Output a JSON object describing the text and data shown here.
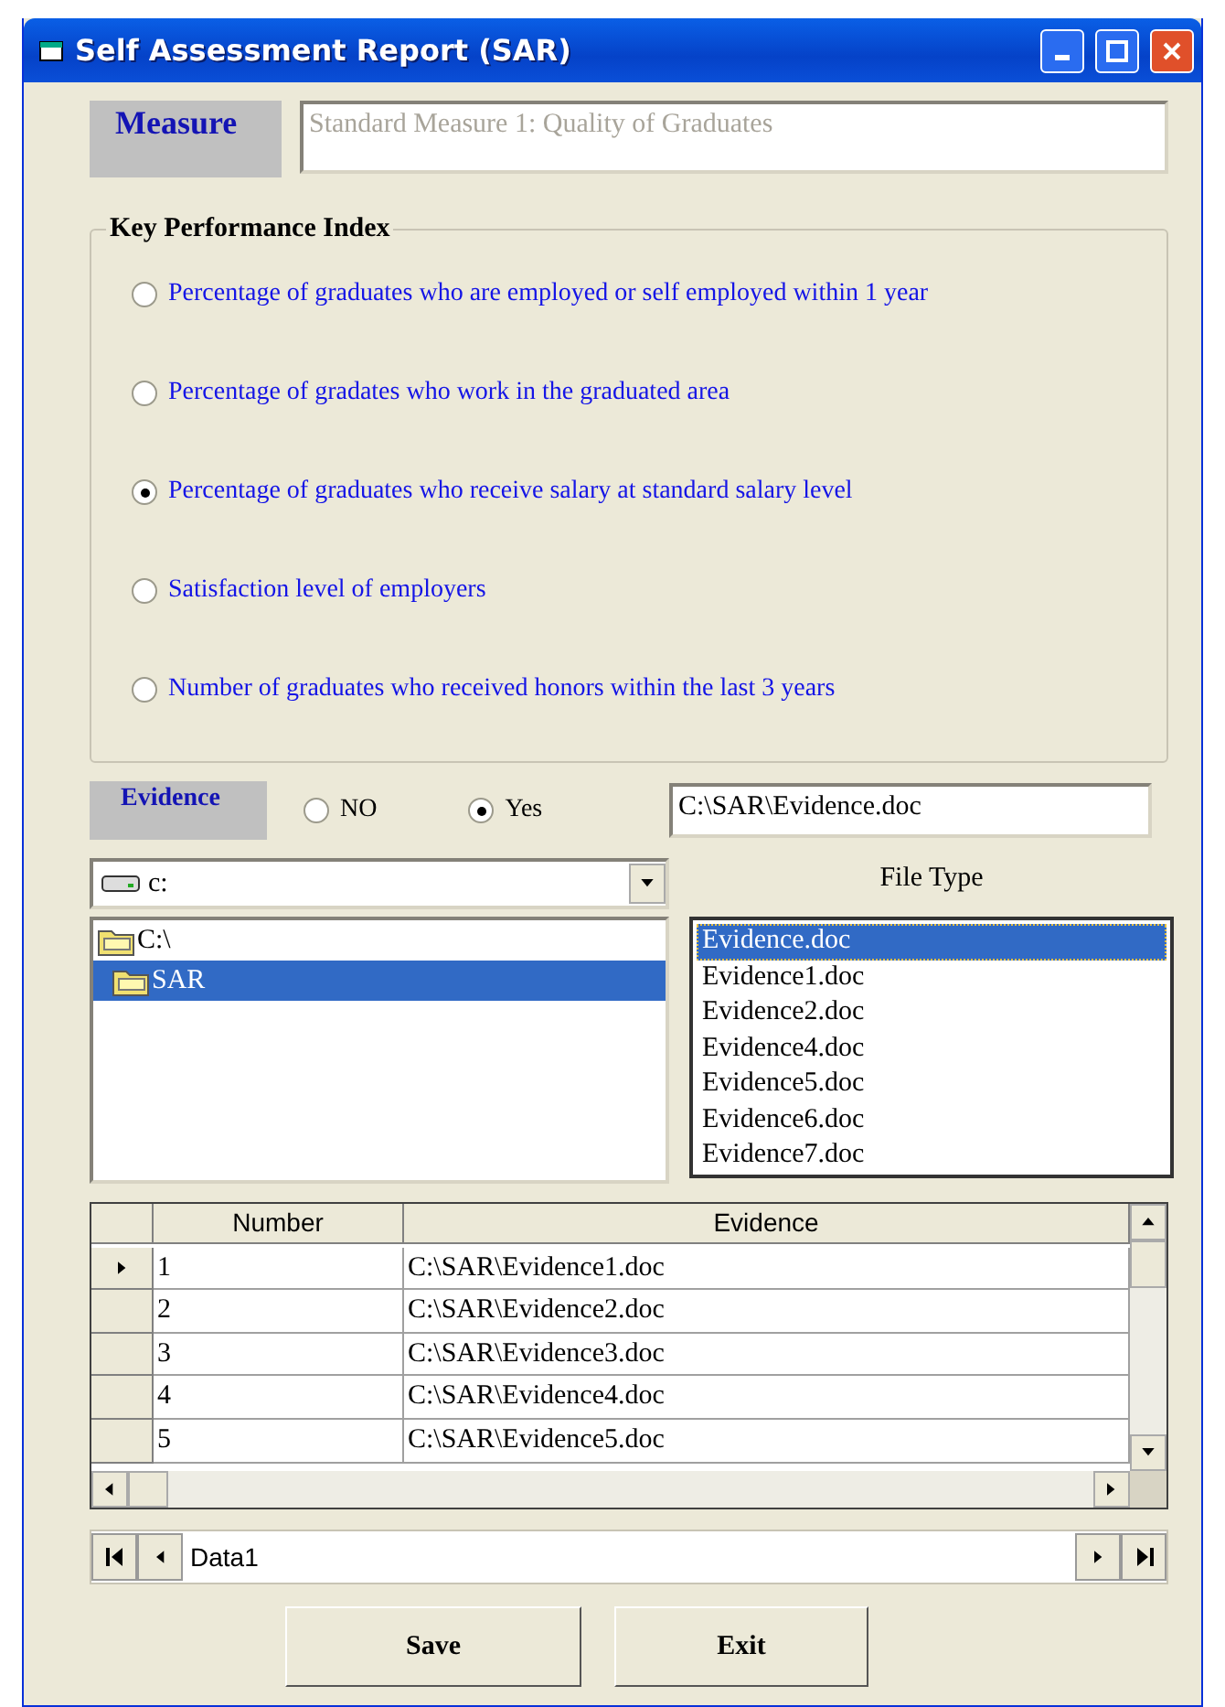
{
  "window": {
    "title": "Self Assessment  Report (SAR)"
  },
  "measure": {
    "label": "Measure",
    "value": "Standard Measure 1: Quality of Graduates"
  },
  "kpi": {
    "title": "Key Performance Index",
    "options": [
      {
        "label": "Percentage of graduates who are employed or self employed within 1 year",
        "selected": false
      },
      {
        "label": "Percentage of gradates who work in the graduated area",
        "selected": false
      },
      {
        "label": "Percentage of graduates who receive salary at standard salary level",
        "selected": true
      },
      {
        "label": "Satisfaction level of employers",
        "selected": false
      },
      {
        "label": "Number of graduates who received honors within the last 3 years",
        "selected": false
      }
    ]
  },
  "evidence": {
    "label": "Evidence",
    "options": [
      {
        "label": "NO",
        "selected": false
      },
      {
        "label": "Yes",
        "selected": true
      }
    ],
    "path": "C:\\SAR\\Evidence.doc"
  },
  "drive": {
    "value": "c:"
  },
  "folders": [
    {
      "label": "C:\\",
      "selected": false,
      "children": [
        {
          "label": "SAR",
          "selected": true
        }
      ]
    }
  ],
  "file_type": {
    "label": "File Type",
    "files": [
      {
        "label": "Evidence.doc",
        "selected": true
      },
      {
        "label": "Evidence1.doc",
        "selected": false
      },
      {
        "label": "Evidence2.doc",
        "selected": false
      },
      {
        "label": "Evidence4.doc",
        "selected": false
      },
      {
        "label": "Evidence5.doc",
        "selected": false
      },
      {
        "label": "Evidence6.doc",
        "selected": false
      },
      {
        "label": "Evidence7.doc",
        "selected": false
      }
    ]
  },
  "grid": {
    "columns": [
      "Number",
      "Evidence"
    ],
    "rows": [
      {
        "cells": [
          "1",
          "C:\\SAR\\Evidence1.doc"
        ],
        "current": true
      },
      {
        "cells": [
          "2",
          "C:\\SAR\\Evidence2.doc"
        ],
        "current": false
      },
      {
        "cells": [
          "3",
          "C:\\SAR\\Evidence3.doc"
        ],
        "current": false
      },
      {
        "cells": [
          "4",
          "C:\\SAR\\Evidence4.doc"
        ],
        "current": false
      },
      {
        "cells": [
          "5",
          "C:\\SAR\\Evidence5.doc"
        ],
        "current": false
      }
    ]
  },
  "data_control": {
    "caption": "Data1"
  },
  "buttons": [
    "Save",
    "Exit"
  ]
}
